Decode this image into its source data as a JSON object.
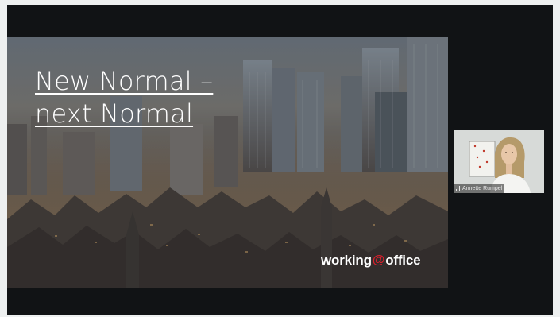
{
  "slide": {
    "title_line1": "New Normal –",
    "title_line2": "next Normal",
    "logo": {
      "text_left": "working",
      "at_symbol": "@",
      "text_right": "office"
    }
  },
  "participant": {
    "name": "Annette Rumpel",
    "icon": "signal-bars-icon"
  },
  "colors": {
    "stage_background": "#111315",
    "page_background": "#eef0f0",
    "logo_accent": "#d8202c",
    "title_text": "#ffffff"
  }
}
